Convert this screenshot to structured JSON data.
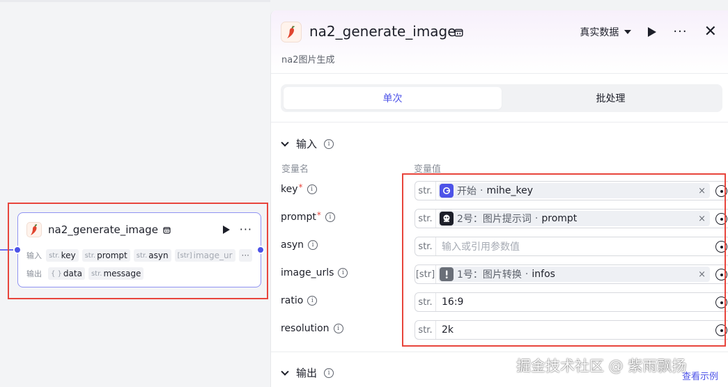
{
  "node": {
    "title": "na2_generate_image",
    "input_label": "输入",
    "output_label": "输出",
    "inputs": [
      {
        "type": "str.",
        "name": "key"
      },
      {
        "type": "str.",
        "name": "prompt"
      },
      {
        "type": "str.",
        "name": "asyn"
      },
      {
        "type": "[str]",
        "name": "image_ur"
      }
    ],
    "more_label": "···",
    "outputs": [
      {
        "type": "{ }",
        "name": "data"
      },
      {
        "type": "str.",
        "name": "message"
      }
    ]
  },
  "panel": {
    "title": "na2_generate_image",
    "subtitle": "na2图片生成",
    "data_mode": "真实数据",
    "tabs": [
      {
        "label": "单次",
        "active": true
      },
      {
        "label": "批处理",
        "active": false
      }
    ],
    "input_section": "输入",
    "output_section": "输出",
    "col_name": "变量名",
    "col_value": "变量值",
    "params": [
      {
        "name": "key",
        "required": true,
        "type": "str.",
        "kind": "ref",
        "icon": "start",
        "node": "开始",
        "var": "mihe_key"
      },
      {
        "name": "prompt",
        "required": true,
        "type": "str.",
        "kind": "ref",
        "icon": "prompt",
        "node": "2号：图片提示词",
        "var": "prompt"
      },
      {
        "name": "asyn",
        "required": false,
        "type": "str.",
        "kind": "empty",
        "placeholder": "输入或引用参数值"
      },
      {
        "name": "image_urls",
        "required": false,
        "type": "[str]",
        "kind": "ref",
        "icon": "conv",
        "node": "1号：图片转换",
        "var": "infos"
      },
      {
        "name": "ratio",
        "required": false,
        "type": "str.",
        "kind": "text",
        "value": "16:9"
      },
      {
        "name": "resolution",
        "required": false,
        "type": "str.",
        "kind": "text",
        "value": "2k"
      }
    ],
    "separator": "·",
    "clear_label": "×",
    "example_link": "查看示例"
  },
  "watermark": "掘金技术社区 @ 紫雨飘扬",
  "colors": {
    "accent": "#4d53e8",
    "highlight": "#e8453c"
  }
}
